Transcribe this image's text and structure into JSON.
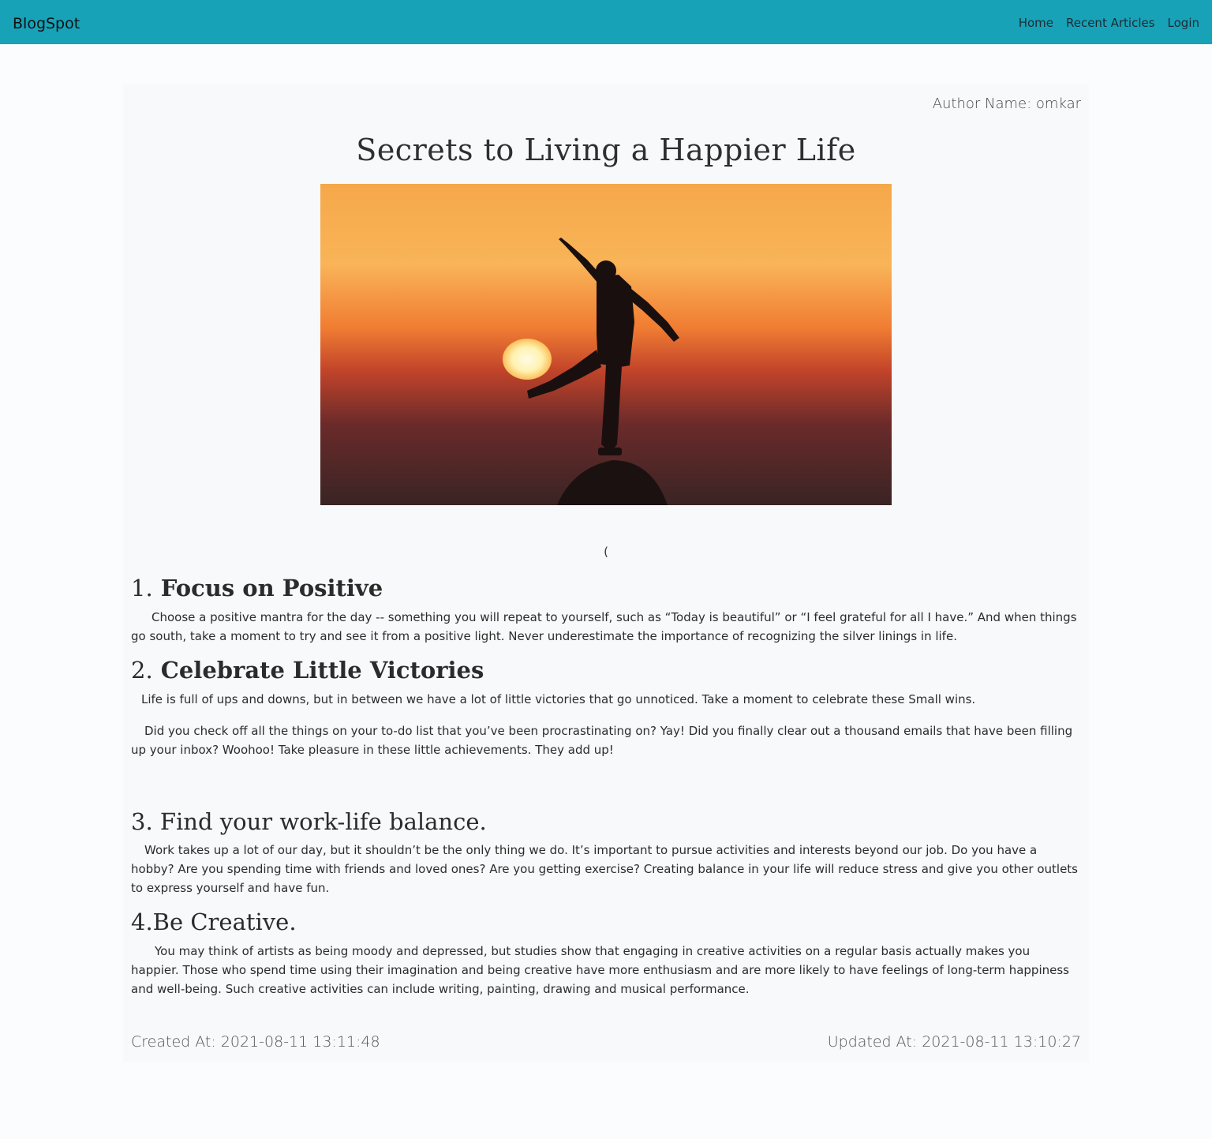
{
  "navbar": {
    "brand": "BlogSpot",
    "links": [
      "Home",
      "Recent Articles",
      "Login"
    ],
    "background": "#17a2b8"
  },
  "article": {
    "author": "Author Name: omkar",
    "title": "Secrets to Living a Happier Life",
    "image_icon": "sunset-silhouette-photo",
    "stray_char": "(",
    "sections": [
      {
        "num": "1.",
        "heading": " Focus on Positive",
        "paragraphs": [
          "Choose a positive mantra for the day -- something you will repeat to yourself, such as “Today is beautiful” or “I feel grateful for all I have.” And when things go south, take a moment to try and see it from a positive light. Never underestimate the importance of recognizing the silver linings in life."
        ]
      },
      {
        "num": "2.",
        "heading": " Celebrate Little Victories",
        "paragraphs": [
          "Life is full of ups and downs, but in between we have a lot of little victories that go unnoticed. Take a moment to celebrate these Small wins.",
          "Did you check off all the things on your to-do list that you’ve been procrastinating on? Yay! Did you finally clear out a thousand emails that have been filling up your inbox? Woohoo! Take pleasure in these little achievements. They add up!"
        ]
      },
      {
        "num": "3.",
        "heading": " Find your work-life balance.",
        "paragraphs": [
          "Work takes up a lot of our day, but it shouldn’t be the only thing we do. It’s important to pursue activities and interests beyond our job. Do you have a hobby? Are you spending time with friends and loved ones? Are you getting exercise? Creating balance in your life will reduce stress and give you other outlets to express yourself and have fun."
        ]
      },
      {
        "num": "4.",
        "heading": "Be Creative.",
        "paragraphs": [
          "You may think of artists as being moody and depressed, but studies show that engaging in creative activities on a regular basis actually makes you happier. Those who spend time using their imagination and being creative have more enthusiasm and are more likely to have feelings of long-term happiness and well-being. Such creative activities can include writing, painting, drawing and musical performance."
        ]
      }
    ],
    "created_at": "Created At: 2021-08-11 13:11:48",
    "updated_at": "Updated At: 2021-08-11 13:10:27"
  }
}
